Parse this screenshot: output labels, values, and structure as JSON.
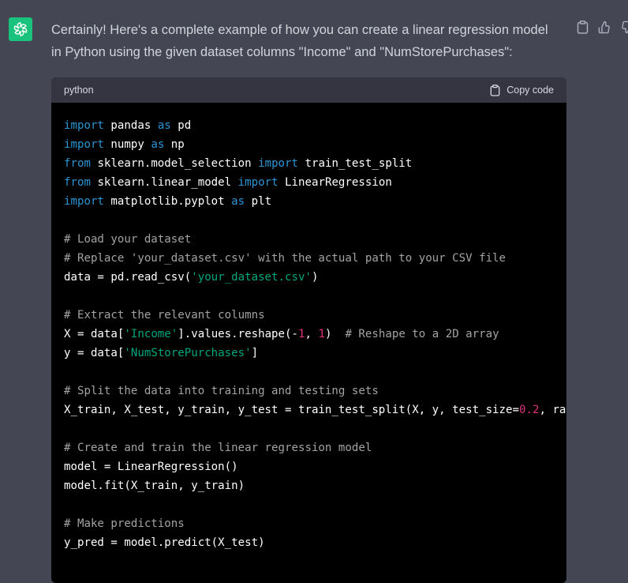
{
  "message": {
    "text": "Certainly! Here's a complete example of how you can create a linear regression model in Python using the given dataset columns \"Income\" and \"NumStorePurchases\":"
  },
  "code_block": {
    "language": "python",
    "copy_label": "Copy code",
    "lines": [
      [
        {
          "t": "kw",
          "v": "import"
        },
        {
          "t": "p",
          "v": " pandas "
        },
        {
          "t": "kw",
          "v": "as"
        },
        {
          "t": "p",
          "v": " pd"
        }
      ],
      [
        {
          "t": "kw",
          "v": "import"
        },
        {
          "t": "p",
          "v": " numpy "
        },
        {
          "t": "kw",
          "v": "as"
        },
        {
          "t": "p",
          "v": " np"
        }
      ],
      [
        {
          "t": "kw",
          "v": "from"
        },
        {
          "t": "p",
          "v": " sklearn.model_selection "
        },
        {
          "t": "kw",
          "v": "import"
        },
        {
          "t": "p",
          "v": " train_test_split"
        }
      ],
      [
        {
          "t": "kw",
          "v": "from"
        },
        {
          "t": "p",
          "v": " sklearn.linear_model "
        },
        {
          "t": "kw",
          "v": "import"
        },
        {
          "t": "p",
          "v": " LinearRegression"
        }
      ],
      [
        {
          "t": "kw",
          "v": "import"
        },
        {
          "t": "p",
          "v": " matplotlib.pyplot "
        },
        {
          "t": "kw",
          "v": "as"
        },
        {
          "t": "p",
          "v": " plt"
        }
      ],
      [],
      [
        {
          "t": "cm",
          "v": "# Load your dataset"
        }
      ],
      [
        {
          "t": "cm",
          "v": "# Replace 'your_dataset.csv' with the actual path to your CSV file"
        }
      ],
      [
        {
          "t": "p",
          "v": "data = pd.read_csv("
        },
        {
          "t": "str",
          "v": "'your_dataset.csv'"
        },
        {
          "t": "p",
          "v": ")"
        }
      ],
      [],
      [
        {
          "t": "cm",
          "v": "# Extract the relevant columns"
        }
      ],
      [
        {
          "t": "p",
          "v": "X = data["
        },
        {
          "t": "str",
          "v": "'Income'"
        },
        {
          "t": "p",
          "v": "].values.reshape(-"
        },
        {
          "t": "num",
          "v": "1"
        },
        {
          "t": "p",
          "v": ", "
        },
        {
          "t": "num",
          "v": "1"
        },
        {
          "t": "p",
          "v": ")  "
        },
        {
          "t": "cm",
          "v": "# Reshape to a 2D array"
        }
      ],
      [
        {
          "t": "p",
          "v": "y = data["
        },
        {
          "t": "str",
          "v": "'NumStorePurchases'"
        },
        {
          "t": "p",
          "v": "]"
        }
      ],
      [],
      [
        {
          "t": "cm",
          "v": "# Split the data into training and testing sets"
        }
      ],
      [
        {
          "t": "p",
          "v": "X_train, X_test, y_train, y_test = train_test_split(X, y, test_size="
        },
        {
          "t": "num",
          "v": "0.2"
        },
        {
          "t": "p",
          "v": ", ran"
        }
      ],
      [],
      [
        {
          "t": "cm",
          "v": "# Create and train the linear regression model"
        }
      ],
      [
        {
          "t": "p",
          "v": "model = LinearRegression()"
        }
      ],
      [
        {
          "t": "p",
          "v": "model.fit(X_train, y_train)"
        }
      ],
      [],
      [
        {
          "t": "cm",
          "v": "# Make predictions"
        }
      ],
      [
        {
          "t": "p",
          "v": "y_pred = model.predict(X_test)"
        }
      ]
    ]
  },
  "icons": {
    "avatar": "openai-logo-icon",
    "copy_message": "clipboard-icon",
    "thumbs_up": "thumbs-up-icon",
    "thumbs_down": "thumbs-down-icon",
    "copy_code": "clipboard-icon"
  },
  "colors": {
    "page_bg": "#444654",
    "avatar_bg": "#19c37d",
    "code_bg": "#000000",
    "code_header_bg": "#343541",
    "keyword": "#2e95d3",
    "string": "#00a67d",
    "number": "#df3079",
    "comment": "#a3a3a3"
  }
}
